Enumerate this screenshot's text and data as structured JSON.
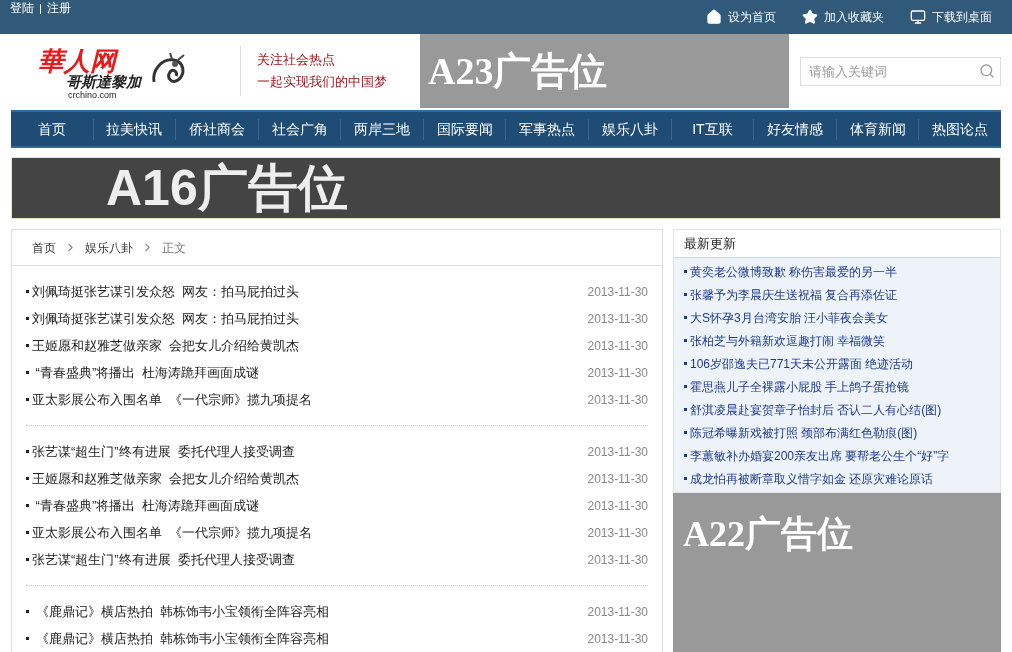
{
  "top_bar": {
    "account_links": [
      "登陆",
      "注册"
    ],
    "links": [
      {
        "kind": "home",
        "label": "设为首页"
      },
      {
        "kind": "star",
        "label": "加入收藏夹"
      },
      {
        "kind": "monitor",
        "label": "下载到桌面"
      }
    ]
  },
  "header": {
    "logo": {
      "name": "華人网",
      "subtitle": "哥斯達黎加",
      "domain": "crchino.com"
    },
    "slogan": [
      "关注社会热点",
      "一起实现我们的中国梦"
    ],
    "ad_label": "A23广告位",
    "search": {
      "placeholder": "请输入关键词"
    }
  },
  "nav": [
    {
      "label": "首页"
    },
    {
      "label": "拉美快讯"
    },
    {
      "label": "侨社商会"
    },
    {
      "label": "社会广角"
    },
    {
      "label": "两岸三地"
    },
    {
      "label": "国际要闻"
    },
    {
      "label": "军事热点"
    },
    {
      "label": "娱乐八卦"
    },
    {
      "label": "IT互联"
    },
    {
      "label": "好友情感"
    },
    {
      "label": "体育新闻"
    },
    {
      "label": "热图论点"
    }
  ],
  "banner_ad": "A16广告位",
  "breadcrumb": [
    "首页",
    "娱乐八卦",
    "正文"
  ],
  "article_groups": [
    {
      "items": [
        {
          "title": "刘佩琦挺张艺谋引发众怒  网友：拍马屁拍过头",
          "date": "2013-11-30"
        },
        {
          "title": "刘佩琦挺张艺谋引发众怒  网友：拍马屁拍过头",
          "date": "2013-11-30"
        },
        {
          "title": "王姬愿和赵雅芝做亲家  会把女儿介绍给黄凯杰",
          "date": "2013-11-30"
        },
        {
          "title": " “青春盛典”将播出  杜海涛跪拜画面成谜",
          "date": "2013-11-30"
        },
        {
          "title": "亚太影展公布入围名单  《一代宗师》揽九项提名",
          "date": "2013-11-30"
        }
      ]
    },
    {
      "items": [
        {
          "title": "张艺谋“超生门”终有进展  委托代理人接受调查",
          "date": "2013-11-30"
        },
        {
          "title": "王姬愿和赵雅芝做亲家  会把女儿介绍给黄凯杰",
          "date": "2013-11-30"
        },
        {
          "title": " “青春盛典”将播出  杜海涛跪拜画面成谜",
          "date": "2013-11-30"
        },
        {
          "title": "亚太影展公布入围名单  《一代宗师》揽九项提名",
          "date": "2013-11-30"
        },
        {
          "title": "张艺谋“超生门”终有进展  委托代理人接受调查",
          "date": "2013-11-30"
        }
      ]
    },
    {
      "items": [
        {
          "title": " 《鹿鼎记》横店热拍  韩栋饰韦小宝领衔全阵容亮相",
          "date": "2013-11-30"
        },
        {
          "title": " 《鹿鼎记》横店热拍  韩栋饰韦小宝领衔全阵容亮相",
          "date": "2013-11-30"
        }
      ]
    }
  ],
  "latest": {
    "title": "最新更新",
    "items": [
      "黄奕老公微博致歉 称伤害最爱的另一半",
      "张馨予为李晨庆生送祝福 复合再添佐证",
      "大S怀孕3月台湾安胎 汪小菲夜会美女",
      "张柏芝与外籍新欢逗趣打闹 幸福微笑",
      "106岁邵逸夫已771天未公开露面 绝迹活动",
      "霍思燕儿子全裸露小屁股 手上鸽子蛋抢镜",
      "舒淇凌晨赴宴贺章子怡封后 否认二人有心结(图)",
      "陈冠希曝新戏被打照 颈部布满红色勒痕(图)",
      "李蕙敏补办婚宴200亲友出席 要帮老公生个“好”字",
      "成龙怕再被断章取义惜字如金 还原灾难论原话"
    ]
  },
  "side_ad": "A22广告位"
}
